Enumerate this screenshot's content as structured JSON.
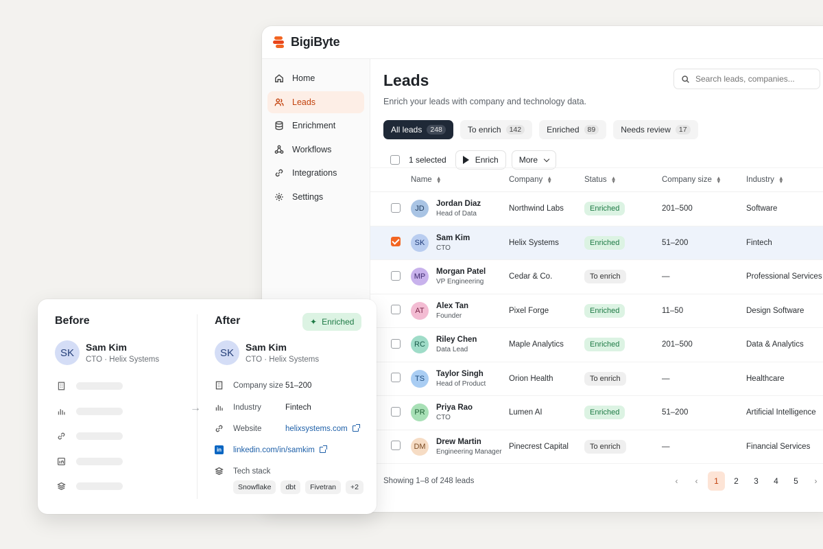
{
  "app": {
    "brand": "BigiByte"
  },
  "sidebar": {
    "items": [
      {
        "label": "Home",
        "icon": "home-icon"
      },
      {
        "label": "Leads",
        "icon": "users-icon",
        "active": true
      },
      {
        "label": "Enrichment",
        "icon": "database-icon"
      },
      {
        "label": "Workflows",
        "icon": "workflow-icon"
      },
      {
        "label": "Integrations",
        "icon": "link-icon"
      },
      {
        "label": "Settings",
        "icon": "gear-icon"
      }
    ]
  },
  "main": {
    "title": "Leads",
    "subtitle": "Enrich your leads with company and technology data.",
    "search_placeholder": "Search leads, companies...",
    "tabs": [
      {
        "label": "All leads",
        "count": "248",
        "active": true
      },
      {
        "label": "To enrich",
        "count": "142"
      },
      {
        "label": "Enriched",
        "count": "89"
      },
      {
        "label": "Needs review",
        "count": "17"
      }
    ],
    "toolbar": {
      "selected": "1 selected",
      "enrich": "Enrich",
      "more": "More"
    },
    "columns": [
      "Name",
      "Company",
      "Status",
      "Company size",
      "Industry"
    ],
    "rows": [
      {
        "initials": "JD",
        "name": "Jordan Diaz",
        "role": "Head of Data",
        "company": "Northwind Labs",
        "status": "Enriched",
        "size": "201–500",
        "industry": "Software",
        "avatar_bg": "#a9c4e4",
        "avatar_fg": "#1f3a5c"
      },
      {
        "initials": "SK",
        "name": "Sam Kim",
        "role": "CTO",
        "company": "Helix Systems",
        "status": "Enriched",
        "size": "51–200",
        "industry": "Fintech",
        "avatar_bg": "#b9cdf0",
        "avatar_fg": "#1f3a78",
        "selected": true
      },
      {
        "initials": "MP",
        "name": "Morgan Patel",
        "role": "VP Engineering",
        "company": "Cedar & Co.",
        "status": "To enrich",
        "size": "—",
        "industry": "Professional Services",
        "avatar_bg": "#c8b2ec",
        "avatar_fg": "#3e2a6e"
      },
      {
        "initials": "AT",
        "name": "Alex Tan",
        "role": "Founder",
        "company": "Pixel Forge",
        "status": "Enriched",
        "size": "11–50",
        "industry": "Design Software",
        "avatar_bg": "#f3bcd3",
        "avatar_fg": "#7a2448"
      },
      {
        "initials": "RC",
        "name": "Riley Chen",
        "role": "Data Lead",
        "company": "Maple Analytics",
        "status": "Enriched",
        "size": "201–500",
        "industry": "Data & Analytics",
        "avatar_bg": "#9fdcc8",
        "avatar_fg": "#185a48"
      },
      {
        "initials": "TS",
        "name": "Taylor Singh",
        "role": "Head of Product",
        "company": "Orion Health",
        "status": "To enrich",
        "size": "—",
        "industry": "Healthcare",
        "avatar_bg": "#a9cdf3",
        "avatar_fg": "#1d4b7c"
      },
      {
        "initials": "PR",
        "name": "Priya Rao",
        "role": "CTO",
        "company": "Lumen AI",
        "status": "Enriched",
        "size": "51–200",
        "industry": "Artificial Intelligence",
        "avatar_bg": "#a8e0b6",
        "avatar_fg": "#1e6034"
      },
      {
        "initials": "DM",
        "name": "Drew Martin",
        "role": "Engineering Manager",
        "company": "Pinecrest Capital",
        "status": "To enrich",
        "size": "—",
        "industry": "Financial Services",
        "avatar_bg": "#f6dcc4",
        "avatar_fg": "#7a4a22"
      }
    ],
    "footer": "Showing 1–8 of 248 leads",
    "pages": [
      "1",
      "2",
      "3",
      "4",
      "5"
    ],
    "pager_arrows": {
      "first": "‹",
      "prev": "‹",
      "next": "›"
    }
  },
  "card": {
    "before_title": "Before",
    "after_title": "After",
    "badge": "Enriched",
    "badge_icon": "✦",
    "person": {
      "initials": "SK",
      "name": "Sam Kim",
      "sub": "CTO · Helix Systems"
    },
    "arrow": "→",
    "attrs": {
      "company_size_label": "Company size",
      "company_size": "51–200",
      "industry_label": "Industry",
      "industry": "Fintech",
      "website_label": "Website",
      "website": "helixsystems.com",
      "linkedin": "linkedin.com/in/samkim",
      "tech_label": "Tech stack"
    },
    "tech": [
      "Snowflake",
      "dbt",
      "Fivetran",
      "+2"
    ]
  },
  "colors": {
    "accent": "#f26522",
    "enriched_bg": "#dcf3e3",
    "enriched_fg": "#1e7a45",
    "dark_tab": "#1f2937"
  }
}
